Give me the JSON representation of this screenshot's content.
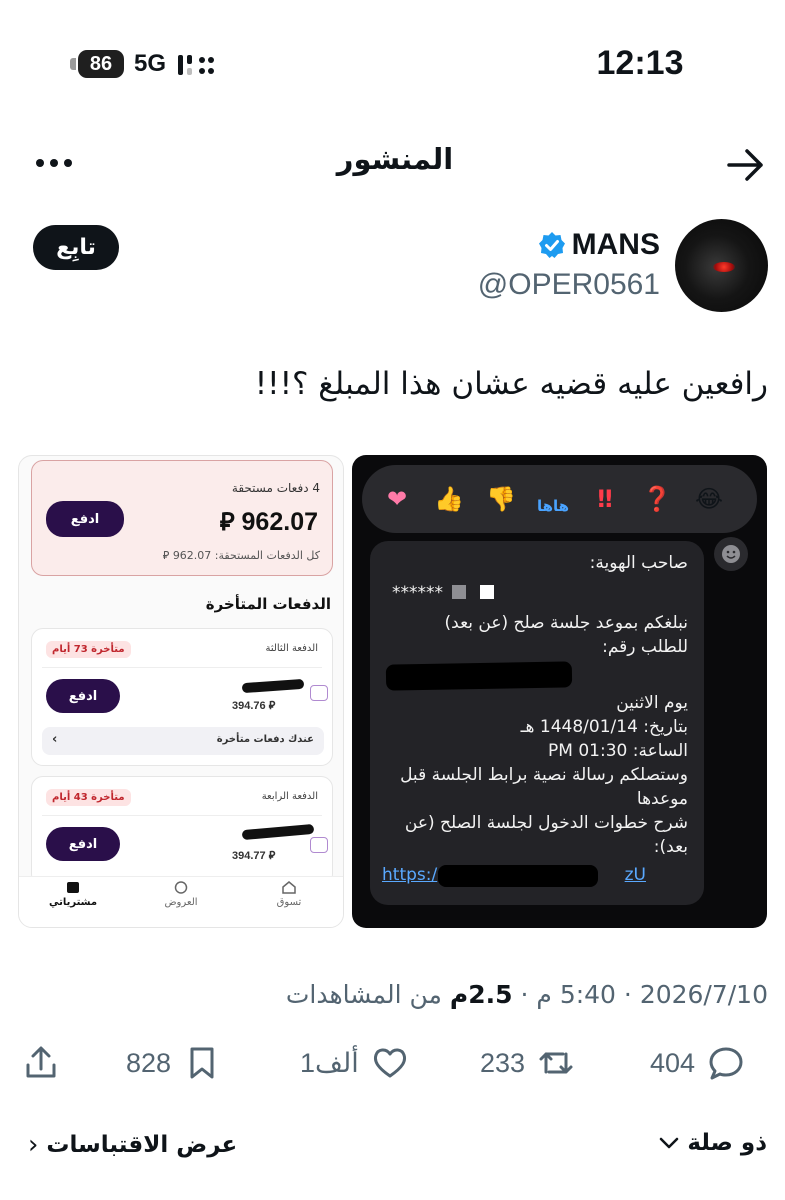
{
  "status_bar": {
    "battery": "86",
    "network": "5G",
    "time": "12:13"
  },
  "header": {
    "title": "المنشور",
    "icons": [
      "more-icon",
      "back-arrow-icon"
    ]
  },
  "author": {
    "display_name": "MANS",
    "handle": "@OPER0561",
    "follow_label": "تابِع",
    "verified": true,
    "verified_color": "#1d9bf0"
  },
  "post": {
    "text": "رافعين عليه قضيه عشان هذا المبلغ ؟!!!"
  },
  "media_left": {
    "due_payments": "4 دفعات مستحقة",
    "amount": "962.07",
    "currency": "⃁",
    "pay_label": "ادفع",
    "total_label": "كل الدفعات المستحقة: 962.07 ⃁",
    "late_heading": "الدفعات المتأخرة",
    "items": [
      {
        "name": "الدفعة الثالثة",
        "badge": "متأخرة 73 أيام",
        "amount": "394.76 ⃁",
        "pay_label": "ادفع",
        "late_note": "عندك دفعات متأخرة"
      },
      {
        "name": "الدفعة الرابعة",
        "badge": "متأخرة 43 أيام",
        "amount": "394.77 ⃁",
        "pay_label": "ادفع"
      }
    ],
    "nav": {
      "purchases": "مشترياتي",
      "offers": "العروض",
      "shop": "تسوق"
    }
  },
  "media_right": {
    "reactions": [
      "❤",
      "👍",
      "👎",
      "هاها",
      "‼",
      "❓",
      "😂"
    ],
    "message": {
      "line1": "صاحب الهوية:",
      "line2": "******",
      "line3": "نبلغكم بموعد جلسة صلح (عن بعد)",
      "line4": "للطلب رقم:",
      "line5": "يوم الاثنين",
      "line6": "بتاريخ: 1448/01/14 هـ",
      "line7": "الساعة: PM 01:30",
      "line8": "وستصلكم رسالة نصية برابط الجلسة قبل موعدها",
      "line9": "شرح خطوات الدخول لجلسة الصلح (عن بعد):",
      "link_start": "https:/",
      "link_end": "zU"
    }
  },
  "meta": {
    "date": "2026/7/10",
    "time": "5:40 م",
    "views_value": "2.5م",
    "views_label": "من المشاهدات"
  },
  "actions": {
    "replies": "404",
    "reposts": "233",
    "likes": "1ألف",
    "bookmarks": "828"
  },
  "bottom": {
    "related": "ذو صلة",
    "quotes": "عرض الاقتباسات"
  }
}
